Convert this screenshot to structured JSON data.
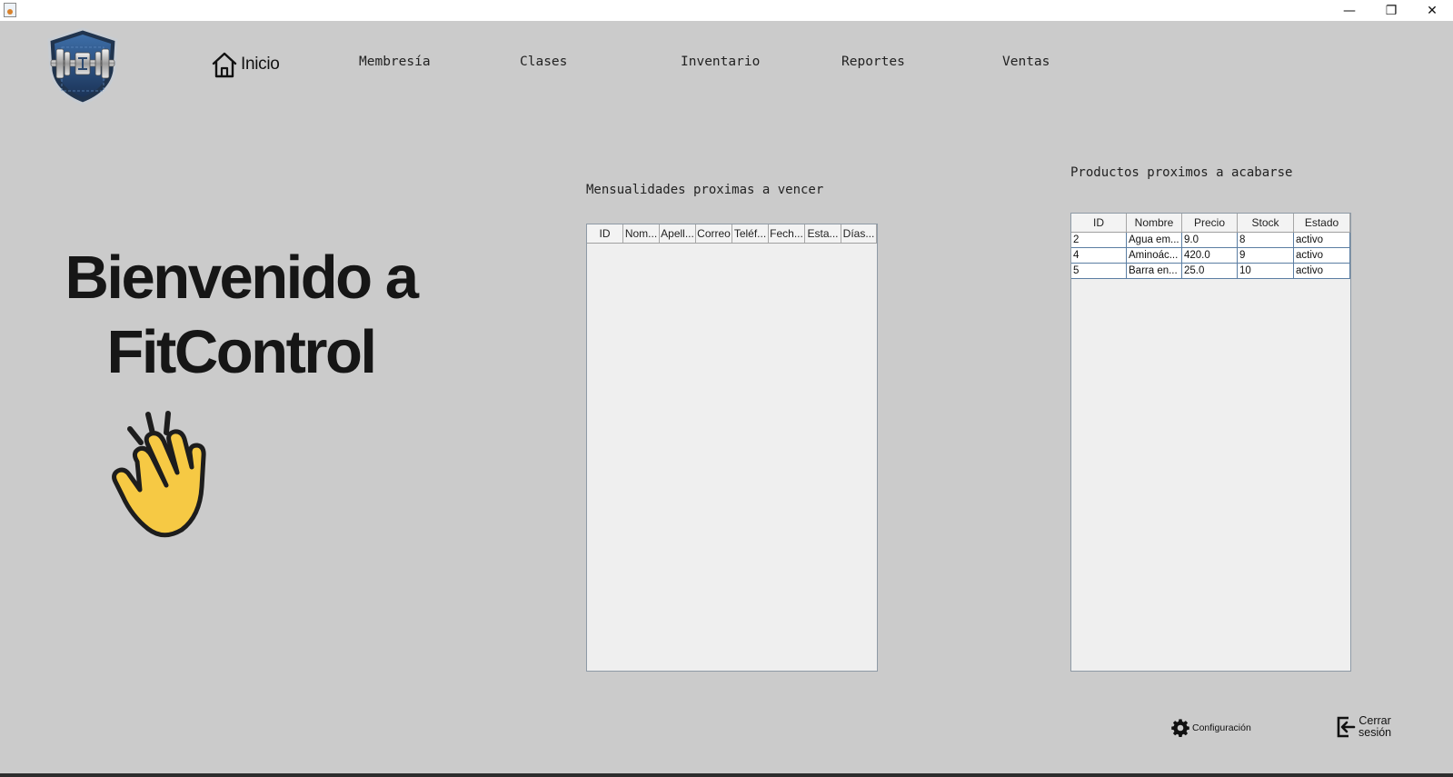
{
  "window": {
    "minimize_glyph": "—",
    "maximize_glyph": "❐",
    "close_glyph": "✕"
  },
  "nav": {
    "home": "Inicio",
    "items": [
      "Membresía",
      "Clases",
      "Inventario",
      "Reportes",
      "Ventas"
    ]
  },
  "hero": {
    "line1": "Bienvenido a",
    "line2": "FitControl",
    "wave_icon": "waving-hand-icon"
  },
  "memberships": {
    "title": "Mensualidades proximas a vencer",
    "columns": [
      "ID",
      "Nom...",
      "Apell...",
      "Correo",
      "Teléf...",
      "Fech...",
      "Esta...",
      "Días..."
    ],
    "rows": []
  },
  "products": {
    "title": "Productos proximos a acabarse",
    "columns": [
      "ID",
      "Nombre",
      "Precio",
      "Stock",
      "Estado"
    ],
    "rows": [
      [
        "2",
        "Agua em...",
        "9.0",
        "8",
        "activo"
      ],
      [
        "4",
        "Aminoác...",
        "420.0",
        "9",
        "activo"
      ],
      [
        "5",
        "Barra en...",
        "25.0",
        "10",
        "activo"
      ]
    ]
  },
  "footer": {
    "settings": "Configuración",
    "logout_line1": "Cerrar",
    "logout_line2": "sesión"
  },
  "colors": {
    "background": "#cbcbcb",
    "table_grid": "#5b7ea3",
    "wave_fill": "#f6c944"
  }
}
